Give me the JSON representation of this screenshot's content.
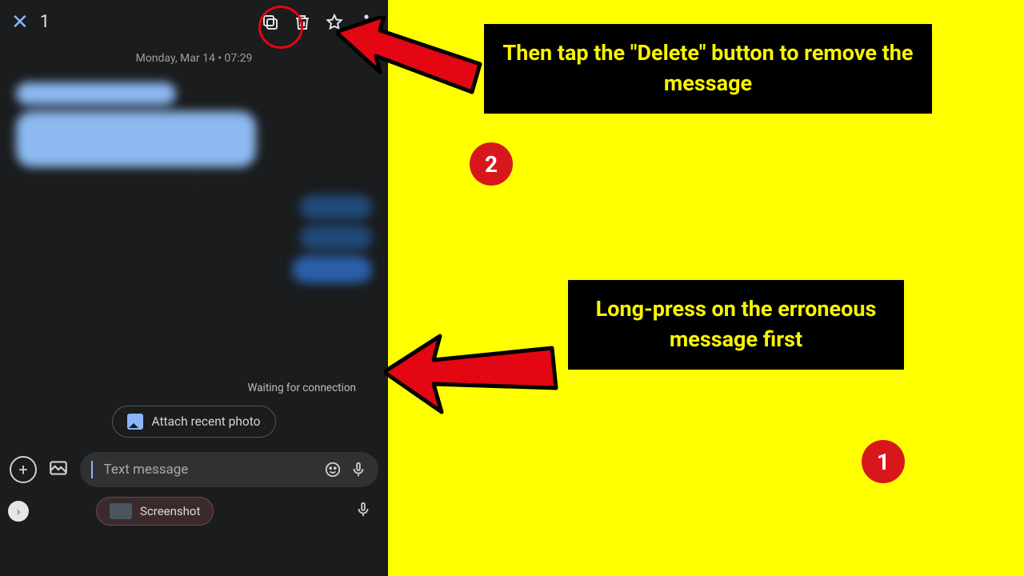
{
  "phone": {
    "selection_count": "1",
    "date_line": "Monday, Mar 14 • 07:29",
    "waiting_text": "Waiting for connection",
    "attach_label": "Attach recent photo",
    "input_placeholder": "Text message",
    "suggestion_label": "Screenshot"
  },
  "callouts": {
    "step2_text": "Then tap the \"Delete\" button to remove the message",
    "step1_text": "Long-press on the erroneous message first",
    "badge1": "1",
    "badge2": "2"
  }
}
